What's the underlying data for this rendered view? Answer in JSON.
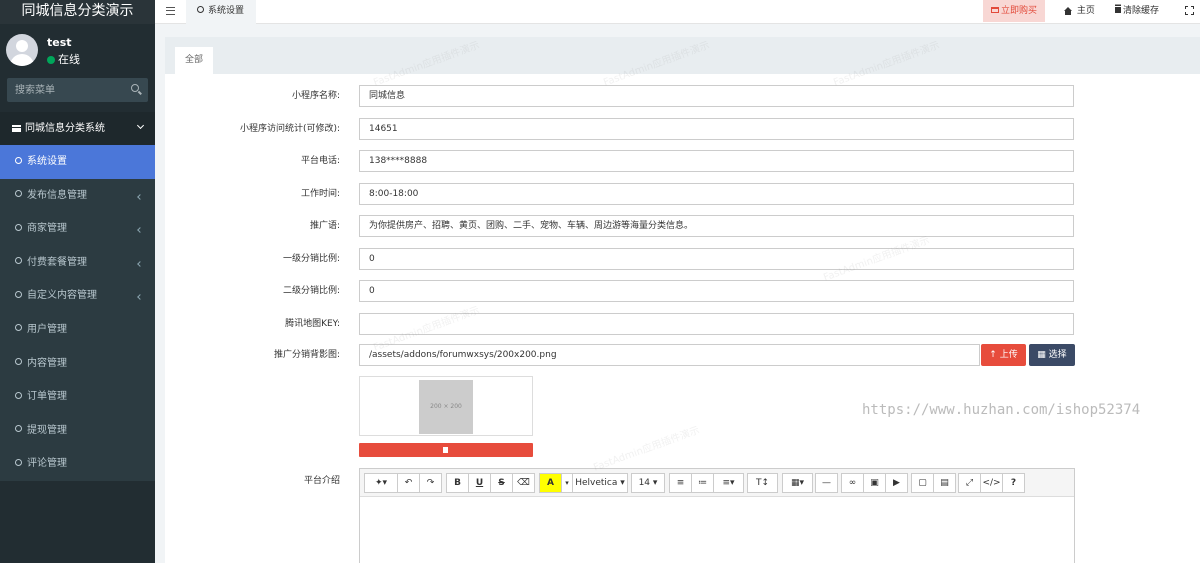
{
  "app": {
    "title": "同城信息分类演示"
  },
  "user": {
    "name": "test",
    "status": "在线"
  },
  "sidebar": {
    "search_placeholder": "搜索菜单",
    "section": "同城信息分类系统",
    "items": [
      {
        "label": "系统设置",
        "active": true
      },
      {
        "label": "发布信息管理"
      },
      {
        "label": "商家管理"
      },
      {
        "label": "付费套餐管理"
      },
      {
        "label": "自定义内容管理"
      },
      {
        "label": "用户管理"
      },
      {
        "label": "内容管理"
      },
      {
        "label": "订单管理"
      },
      {
        "label": "提现管理"
      },
      {
        "label": "评论管理"
      }
    ]
  },
  "topbar": {
    "tab_label": "系统设置",
    "buy_label": "立即购买",
    "home_label": "主页",
    "clear_cache_label": "清除缓存"
  },
  "panel": {
    "tab": "全部",
    "fields": [
      {
        "label": "小程序名称:",
        "value": "同城信息"
      },
      {
        "label": "小程序访问统计(可修改):",
        "value": "14651"
      },
      {
        "label": "平台电话:",
        "value": "138****8888"
      },
      {
        "label": "工作时间:",
        "value": "8:00-18:00"
      },
      {
        "label": "推广语:",
        "value": "为你提供房产、招聘、黄页、团购、二手、宠物、车辆、周边游等海量分类信息。"
      },
      {
        "label": "一级分销比例:",
        "value": "0"
      },
      {
        "label": "二级分销比例:",
        "value": "0"
      },
      {
        "label": "腾讯地图KEY:",
        "value": ""
      }
    ],
    "image_field": {
      "label": "推广分销背影图:",
      "value": "/assets/addons/forumwxsys/200x200.png",
      "upload_label": "上传",
      "select_label": "选择",
      "preview_text": "200 × 200"
    },
    "editor": {
      "label": "平台介绍",
      "font_name": "Helvetica",
      "font_size": "14"
    }
  },
  "watermark_text": "FastAdmin应用插件演示",
  "overlay_url": "https://www.huzhan.com/ishop52374",
  "colors": {
    "sidebar": "#222d32",
    "active": "#4b77d9",
    "danger": "#e74c3c",
    "select": "#3b4a66"
  }
}
